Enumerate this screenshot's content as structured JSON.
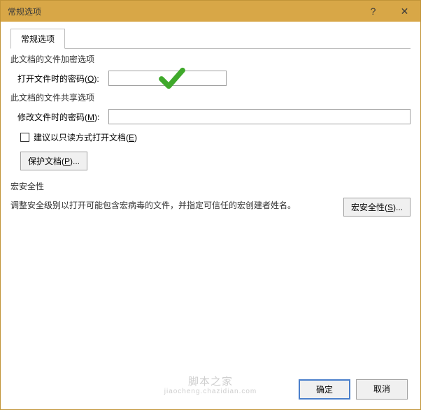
{
  "titlebar": {
    "title": "常规选项",
    "help_symbol": "?",
    "close_symbol": "✕"
  },
  "tabs": {
    "active_label": "常规选项"
  },
  "encrypt_section": {
    "header": "此文档的文件加密选项",
    "open_label_pre": "打开文件时的密码(",
    "open_label_u": "O",
    "open_label_post": "):"
  },
  "share_section": {
    "header": "此文档的文件共享选项",
    "modify_label_pre": "修改文件时的密码(",
    "modify_label_u": "M",
    "modify_label_post": "):"
  },
  "readonly_row": {
    "label_pre": "建议以只读方式打开文档(",
    "label_u": "E",
    "label_post": ")"
  },
  "protect_btn": {
    "label_pre": "保护文档(",
    "label_u": "P",
    "label_post": ")..."
  },
  "macro_section": {
    "header": "宏安全性",
    "desc": "调整安全级别以打开可能包含宏病毒的文件，并指定可信任的宏创建者姓名。",
    "btn_pre": "宏安全性(",
    "btn_u": "S",
    "btn_post": ")..."
  },
  "footer": {
    "ok": "确定",
    "cancel": "取消"
  },
  "watermark": {
    "main": "脚本之家",
    "sub": "jiaocheng.chazidian.com"
  }
}
